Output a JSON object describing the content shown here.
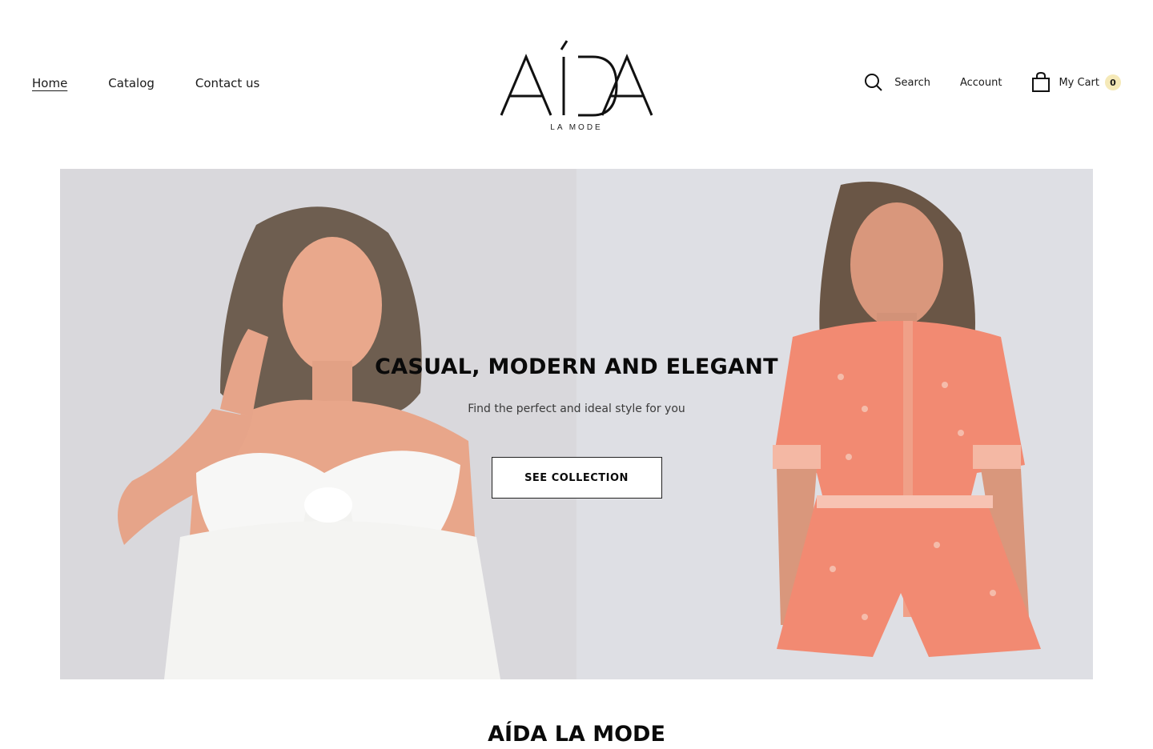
{
  "nav": {
    "left": [
      {
        "label": "Home",
        "active": true
      },
      {
        "label": "Catalog",
        "active": false
      },
      {
        "label": "Contact us",
        "active": false
      }
    ],
    "right": {
      "search_label": "Search",
      "account_label": "Account",
      "cart_label": "My Cart",
      "cart_count": "0"
    }
  },
  "logo": {
    "main_text": "AÍDA",
    "sub_text": "LA MODE"
  },
  "hero": {
    "title": "CASUAL, MODERN AND ELEGANT",
    "subtitle": "Find the perfect and ideal style for you",
    "button_label": "SEE COLLECTION",
    "left_image": "model-white-bow-top",
    "right_image": "model-coral-print-shirt-shorts"
  },
  "section": {
    "title": "AÍDA LA MODE"
  },
  "colors": {
    "cart_badge": "#f5e9b8",
    "hero_left_bg": "#d9d8dc",
    "hero_right_bg": "#dedfe4",
    "coral": "#f07a5e"
  }
}
